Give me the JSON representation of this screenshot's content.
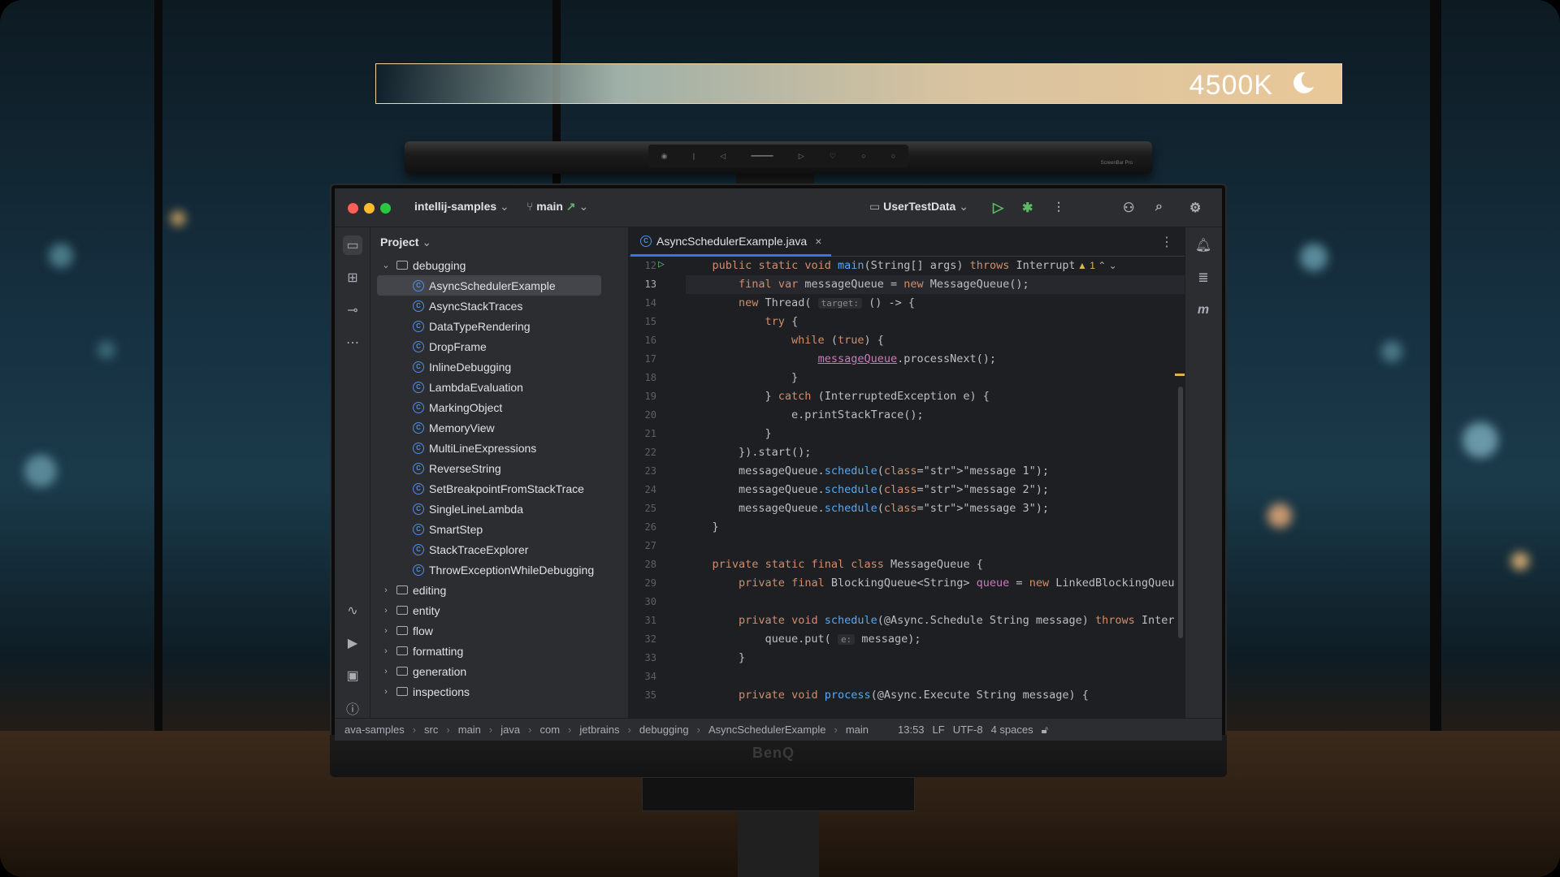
{
  "overlay": {
    "color_temp": "4500K"
  },
  "ide": {
    "project_name": "intellij-samples",
    "branch": "main",
    "run_config": "UserTestData",
    "project_panel_title": "Project",
    "tree": [
      {
        "label": "debugging",
        "kind": "folder",
        "expanded": true,
        "level": 0
      },
      {
        "label": "AsyncSchedulerExample",
        "kind": "class",
        "level": 1,
        "selected": true
      },
      {
        "label": "AsyncStackTraces",
        "kind": "class",
        "level": 1
      },
      {
        "label": "DataTypeRendering",
        "kind": "class",
        "level": 1
      },
      {
        "label": "DropFrame",
        "kind": "class",
        "level": 1
      },
      {
        "label": "InlineDebugging",
        "kind": "class",
        "level": 1
      },
      {
        "label": "LambdaEvaluation",
        "kind": "class",
        "level": 1
      },
      {
        "label": "MarkingObject",
        "kind": "class",
        "level": 1
      },
      {
        "label": "MemoryView",
        "kind": "class",
        "level": 1
      },
      {
        "label": "MultiLineExpressions",
        "kind": "class",
        "level": 1
      },
      {
        "label": "ReverseString",
        "kind": "class",
        "level": 1
      },
      {
        "label": "SetBreakpointFromStackTrace",
        "kind": "class",
        "level": 1
      },
      {
        "label": "SingleLineLambda",
        "kind": "class",
        "level": 1
      },
      {
        "label": "SmartStep",
        "kind": "class",
        "level": 1
      },
      {
        "label": "StackTraceExplorer",
        "kind": "class",
        "level": 1
      },
      {
        "label": "ThrowExceptionWhileDebugging",
        "kind": "class",
        "level": 1
      },
      {
        "label": "editing",
        "kind": "folder",
        "level": 0
      },
      {
        "label": "entity",
        "kind": "folder",
        "level": 0
      },
      {
        "label": "flow",
        "kind": "folder",
        "level": 0
      },
      {
        "label": "formatting",
        "kind": "folder",
        "level": 0
      },
      {
        "label": "generation",
        "kind": "folder",
        "level": 0
      },
      {
        "label": "inspections",
        "kind": "folder",
        "level": 0
      }
    ],
    "tab": {
      "label": "AsyncSchedulerExample.java"
    },
    "warning_count": "1",
    "line_numbers": [
      "12",
      "13",
      "14",
      "15",
      "16",
      "17",
      "18",
      "19",
      "20",
      "21",
      "22",
      "23",
      "24",
      "25",
      "26",
      "27",
      "28",
      "29",
      "30",
      "31",
      "32",
      "33",
      "34",
      "35"
    ],
    "code_lines": [
      "    public static void main(String[] args) throws InterruptedExc",
      "        final var messageQueue = new MessageQueue();",
      "        new Thread( target: () -> {",
      "            try {",
      "                while (true) {",
      "                    messageQueue.processNext();",
      "                }",
      "            } catch (InterruptedException e) {",
      "                e.printStackTrace();",
      "            }",
      "        }).start();",
      "        messageQueue.schedule(\"message 1\");",
      "        messageQueue.schedule(\"message 2\");",
      "        messageQueue.schedule(\"message 3\");",
      "    }",
      "",
      "    private static final class MessageQueue {",
      "        private final BlockingQueue<String> queue = new LinkedBlockingQueu",
      "",
      "        private void schedule(@Async.Schedule String message) throws Inter",
      "            queue.put( e: message);",
      "        }",
      "",
      "        private void process(@Async.Execute String message) {"
    ],
    "breadcrumbs": [
      "ava-samples",
      "src",
      "main",
      "java",
      "com",
      "jetbrains",
      "debugging",
      "AsyncSchedulerExample",
      "main"
    ],
    "status": {
      "position": "13:53",
      "line_sep": "LF",
      "encoding": "UTF-8",
      "indent": "4 spaces"
    }
  },
  "monitor": {
    "brand": "BenQ",
    "lightbar_brand": "ScreenBar Pro"
  },
  "colors": {
    "accent": "#3574f0",
    "keyword": "#cf8e6d",
    "string": "#6aab73",
    "function": "#56a8f5",
    "field": "#c77dbb"
  }
}
